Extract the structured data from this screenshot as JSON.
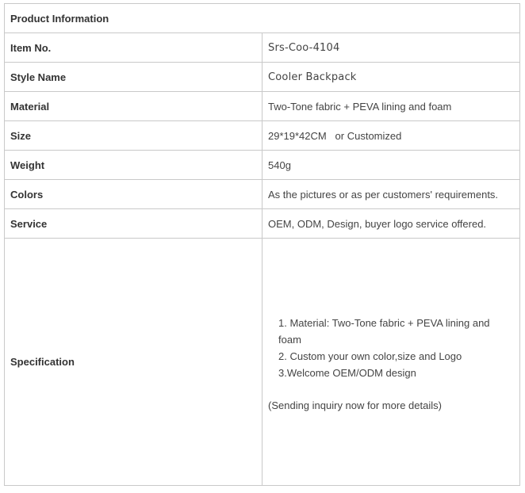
{
  "table": {
    "header": "Product Information",
    "rows": [
      {
        "label": "Item No.",
        "value": "Srs-Coo-4104"
      },
      {
        "label": "Style Name",
        "value": "Cooler Backpack"
      },
      {
        "label": "Material",
        "value": "Two-Tone fabric + PEVA lining and foam"
      },
      {
        "label": "Size",
        "value": "29*19*42CM   or Customized"
      },
      {
        "label": "Weight",
        "value": "540g"
      },
      {
        "label": "Colors",
        "value": "As the pictures or as per customers' requirements."
      },
      {
        "label": "Service",
        "value": "OEM, ODM, Design, buyer logo service offered."
      }
    ],
    "specification": {
      "label": "Specification",
      "items": [
        "1. Material:  Two-Tone fabric + PEVA lining and foam",
        "2. Custom your own color,size and Logo",
        "3.Welcome OEM/ODM design"
      ],
      "note": "(Sending inquiry now for more details)"
    }
  }
}
